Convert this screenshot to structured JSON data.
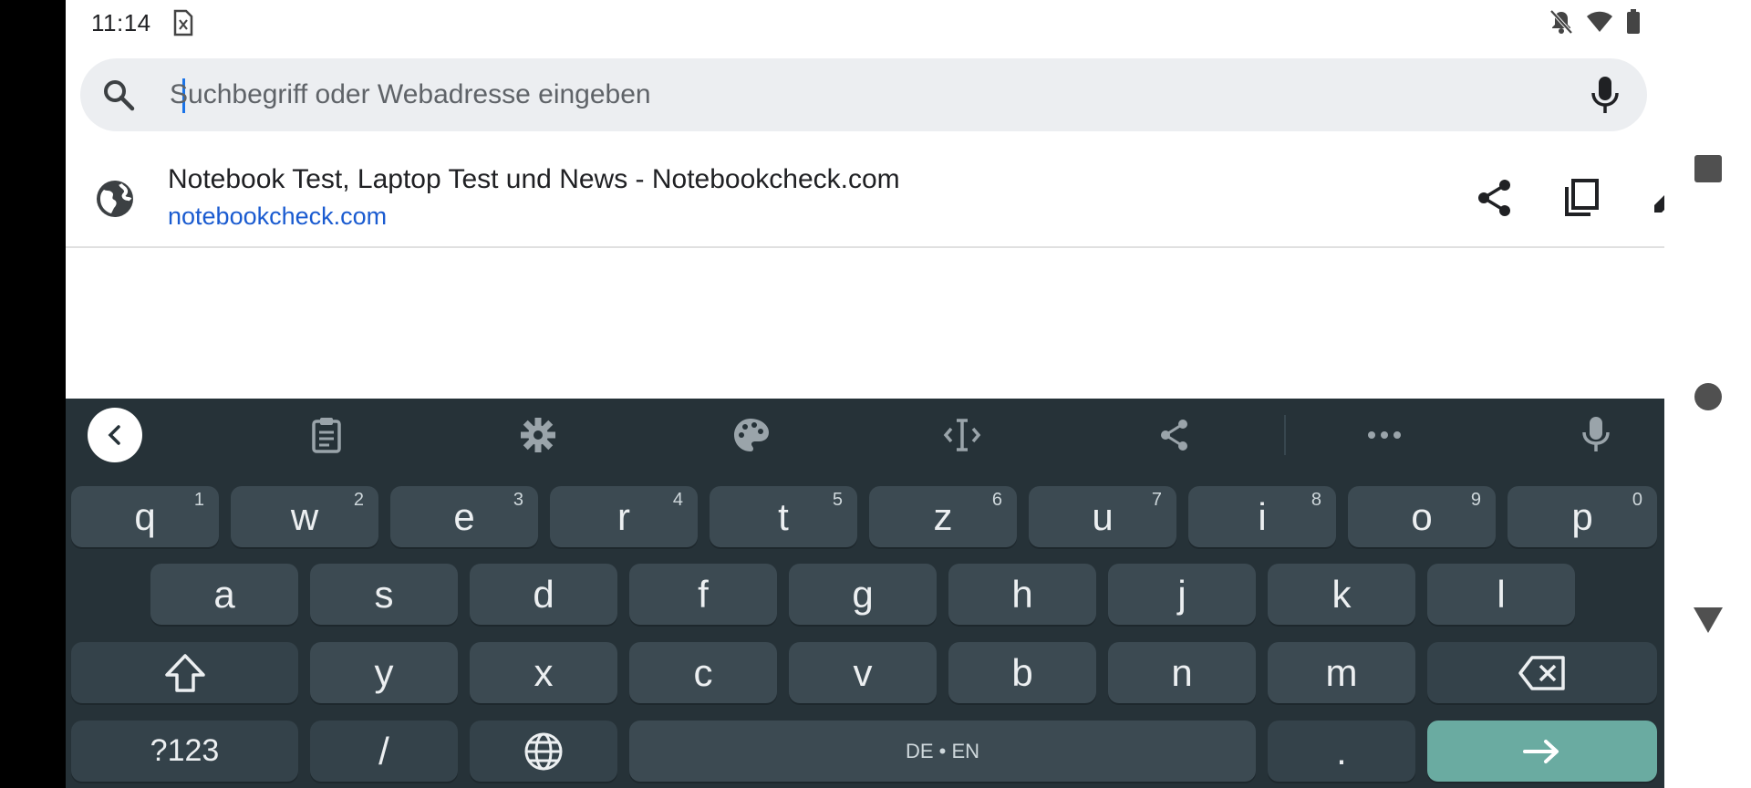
{
  "status_bar": {
    "time": "11:14",
    "icons": [
      "sim-card-error-icon",
      "notifications-off-icon",
      "wifi-icon",
      "battery-icon"
    ]
  },
  "search": {
    "placeholder": "Suchbegriff oder Webadresse eingeben",
    "value": ""
  },
  "suggestion": {
    "title": "Notebook Test, Laptop Test und News - Notebookcheck.com",
    "url": "notebookcheck.com",
    "actions": [
      "share-icon",
      "copy-icon",
      "edit-icon"
    ]
  },
  "keyboard": {
    "toolbar": [
      "back-chevron-icon",
      "clipboard-icon",
      "settings-icon",
      "palette-icon",
      "text-cursor-icon",
      "share-icon",
      "more-icon",
      "mic-icon"
    ],
    "row1": [
      {
        "label": "q",
        "hint": "1"
      },
      {
        "label": "w",
        "hint": "2"
      },
      {
        "label": "e",
        "hint": "3"
      },
      {
        "label": "r",
        "hint": "4"
      },
      {
        "label": "t",
        "hint": "5"
      },
      {
        "label": "z",
        "hint": "6"
      },
      {
        "label": "u",
        "hint": "7"
      },
      {
        "label": "i",
        "hint": "8"
      },
      {
        "label": "o",
        "hint": "9"
      },
      {
        "label": "p",
        "hint": "0"
      }
    ],
    "row2": [
      "a",
      "s",
      "d",
      "f",
      "g",
      "h",
      "j",
      "k",
      "l"
    ],
    "row3": [
      "y",
      "x",
      "c",
      "v",
      "b",
      "n",
      "m"
    ],
    "symbols_label": "?123",
    "slash_label": "/",
    "space_label": "DE • EN",
    "period_label": "."
  },
  "navigation": [
    "recents-square-icon",
    "home-circle-icon",
    "back-triangle-icon"
  ],
  "colors": {
    "keyboard_bg": "#263238",
    "key_bg": "#3c4a52",
    "enter_bg": "#6aaba1",
    "link": "#1a5bd0",
    "search_bg": "#eceef1"
  }
}
